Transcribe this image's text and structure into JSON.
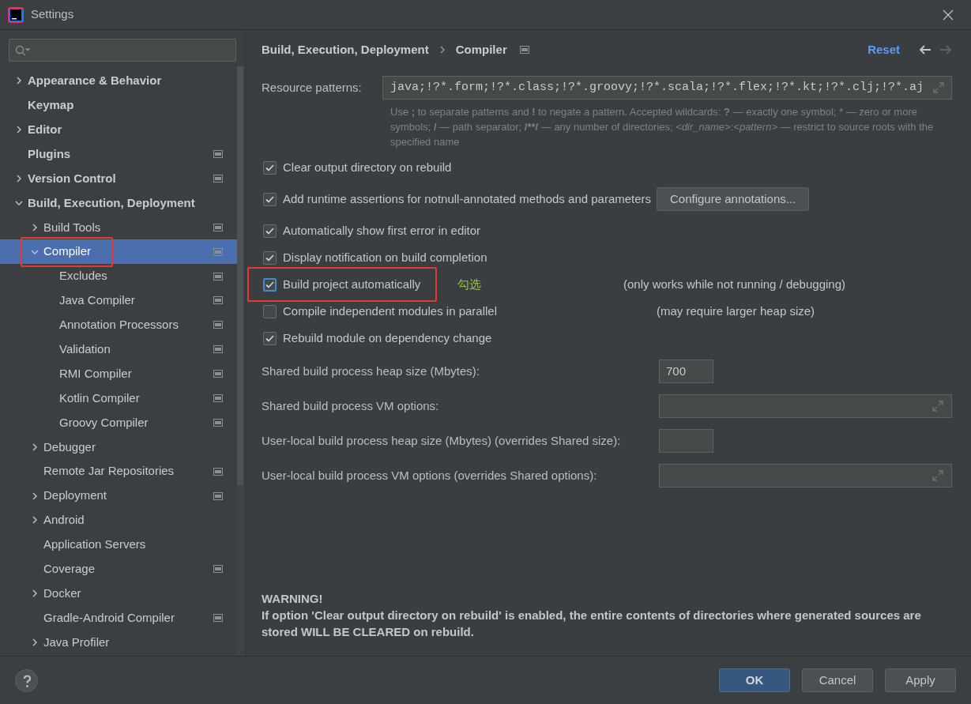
{
  "window": {
    "title": "Settings"
  },
  "tree": [
    {
      "label": "Appearance & Behavior",
      "expanded": false,
      "selected": false,
      "highlighted": false,
      "scoped": false
    },
    {
      "label": "Keymap",
      "selected": false,
      "highlighted": false,
      "scoped": false
    },
    {
      "label": "Editor",
      "expanded": false,
      "selected": false,
      "highlighted": false,
      "scoped": false
    },
    {
      "label": "Plugins",
      "selected": false,
      "highlighted": false,
      "scoped": true
    },
    {
      "label": "Version Control",
      "expanded": false,
      "selected": false,
      "highlighted": false,
      "scoped": true
    },
    {
      "label": "Build, Execution, Deployment",
      "expanded": true,
      "selected": false,
      "highlighted": false,
      "scoped": false,
      "children": [
        {
          "label": "Build Tools",
          "expanded": false,
          "selected": false,
          "highlighted": false,
          "scoped": true
        },
        {
          "label": "Compiler",
          "expanded": true,
          "selected": true,
          "highlighted": true,
          "scoped": true,
          "children": [
            {
              "label": "Excludes",
              "selected": false,
              "highlighted": false,
              "scoped": true
            },
            {
              "label": "Java Compiler",
              "selected": false,
              "highlighted": false,
              "scoped": true
            },
            {
              "label": "Annotation Processors",
              "selected": false,
              "highlighted": false,
              "scoped": true
            },
            {
              "label": "Validation",
              "selected": false,
              "highlighted": false,
              "scoped": true
            },
            {
              "label": "RMI Compiler",
              "selected": false,
              "highlighted": false,
              "scoped": true
            },
            {
              "label": "Kotlin Compiler",
              "selected": false,
              "highlighted": false,
              "scoped": true
            },
            {
              "label": "Groovy Compiler",
              "selected": false,
              "highlighted": false,
              "scoped": true
            }
          ]
        },
        {
          "label": "Debugger",
          "expanded": false,
          "selected": false,
          "highlighted": false,
          "scoped": false
        },
        {
          "label": "Remote Jar Repositories",
          "selected": false,
          "highlighted": false,
          "scoped": true
        },
        {
          "label": "Deployment",
          "expanded": false,
          "selected": false,
          "highlighted": false,
          "scoped": true
        },
        {
          "label": "Android",
          "expanded": false,
          "selected": false,
          "highlighted": false,
          "scoped": false
        },
        {
          "label": "Application Servers",
          "selected": false,
          "highlighted": false,
          "scoped": false
        },
        {
          "label": "Coverage",
          "selected": false,
          "highlighted": false,
          "scoped": true
        },
        {
          "label": "Docker",
          "expanded": false,
          "selected": false,
          "highlighted": false,
          "scoped": false
        },
        {
          "label": "Gradle-Android Compiler",
          "selected": false,
          "highlighted": false,
          "scoped": true
        },
        {
          "label": "Java Profiler",
          "expanded": false,
          "selected": false,
          "highlighted": false,
          "scoped": false
        }
      ]
    }
  ],
  "breadcrumb": [
    "Build, Execution, Deployment",
    "Compiler"
  ],
  "reset": "Reset",
  "resource_patterns": {
    "label": "Resource patterns:",
    "value": "java;!?*.form;!?*.class;!?*.groovy;!?*.scala;!?*.flex;!?*.kt;!?*.clj;!?*.aj"
  },
  "help": [
    {
      "kind": "plain",
      "text": "Use "
    },
    {
      "kind": "bold",
      "text": ";"
    },
    {
      "kind": "plain",
      "text": " to separate patterns and "
    },
    {
      "kind": "bold",
      "text": "!"
    },
    {
      "kind": "plain",
      "text": " to negate a pattern. Accepted wildcards: "
    },
    {
      "kind": "bold",
      "text": "?"
    },
    {
      "kind": "plain",
      "text": " — exactly one symbol; * — zero or more symbols; "
    },
    {
      "kind": "bold",
      "text": "/"
    },
    {
      "kind": "plain",
      "text": " — path separator; "
    },
    {
      "kind": "bold",
      "text": "/**/"
    },
    {
      "kind": "plain",
      "text": " — any number of directories; "
    },
    {
      "kind": "italic",
      "text": "<dir_name>"
    },
    {
      "kind": "plain",
      "text": ":"
    },
    {
      "kind": "italic",
      "text": "<pattern>"
    },
    {
      "kind": "plain",
      "text": " — restrict to source roots with the specified name"
    }
  ],
  "options": [
    {
      "label": "Clear output directory on rebuild",
      "checked": true,
      "highlighted": false
    },
    {
      "label": "Add runtime assertions for notnull-annotated methods and parameters",
      "checked": true,
      "highlighted": false,
      "button": "Configure annotations..."
    },
    {
      "label": "Automatically show first error in editor",
      "checked": true,
      "highlighted": false
    },
    {
      "label": "Display notification on build completion",
      "checked": true,
      "highlighted": false
    },
    {
      "label": "Build project automatically",
      "checked": true,
      "highlighted": true,
      "annotation": "勾选",
      "note": "(only works while not running / debugging)"
    },
    {
      "label": "Compile independent modules in parallel",
      "checked": false,
      "highlighted": false,
      "note": "(may require larger heap size)"
    },
    {
      "label": "Rebuild module on dependency change",
      "checked": true,
      "highlighted": false
    }
  ],
  "fields": [
    {
      "label": "Shared build process heap size (Mbytes):",
      "kind": "short",
      "value": "700"
    },
    {
      "label": "Shared build process VM options:",
      "kind": "expandable"
    },
    {
      "label": "User-local build process heap size (Mbytes) (overrides Shared size):",
      "kind": "short"
    },
    {
      "label": "User-local build process VM options (overrides Shared options):",
      "kind": "expandable"
    }
  ],
  "warning": {
    "title": "WARNING!",
    "text": "If option 'Clear output directory on rebuild' is enabled, the entire contents of directories where generated sources are stored WILL BE CLEARED on rebuild."
  },
  "buttons": [
    {
      "label": "OK",
      "kind": "primary"
    },
    {
      "label": "Cancel",
      "kind": "default"
    },
    {
      "label": "Apply",
      "kind": "default"
    }
  ]
}
